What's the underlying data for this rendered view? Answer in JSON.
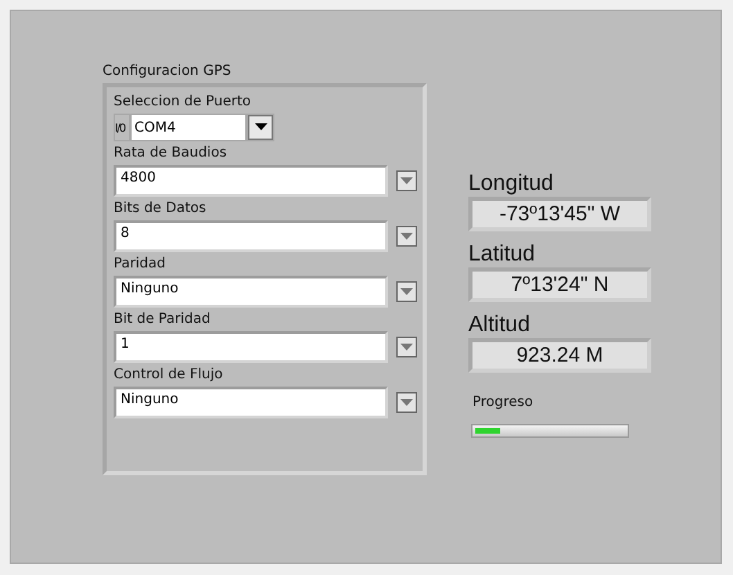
{
  "config_cluster": {
    "title": "Configuracion GPS",
    "port": {
      "label": "Seleccion de Puerto",
      "io_symbol": "I/0",
      "value": "COM4"
    },
    "fields": [
      {
        "label": "Rata de Baudios",
        "value": "4800"
      },
      {
        "label": "Bits de Datos",
        "value": "8"
      },
      {
        "label": "Paridad",
        "value": "Ninguno"
      },
      {
        "label": "Bit de Paridad",
        "value": "1"
      },
      {
        "label": "Control de Flujo",
        "value": "Ninguno"
      }
    ]
  },
  "indicators": [
    {
      "label": "Longitud",
      "value": "-73º13'45\" W"
    },
    {
      "label": "Latitud",
      "value": "7º13'24\" N"
    },
    {
      "label": "Altitud",
      "value": "923.24 M"
    }
  ],
  "progress": {
    "label": "Progreso",
    "level": 0.17
  }
}
